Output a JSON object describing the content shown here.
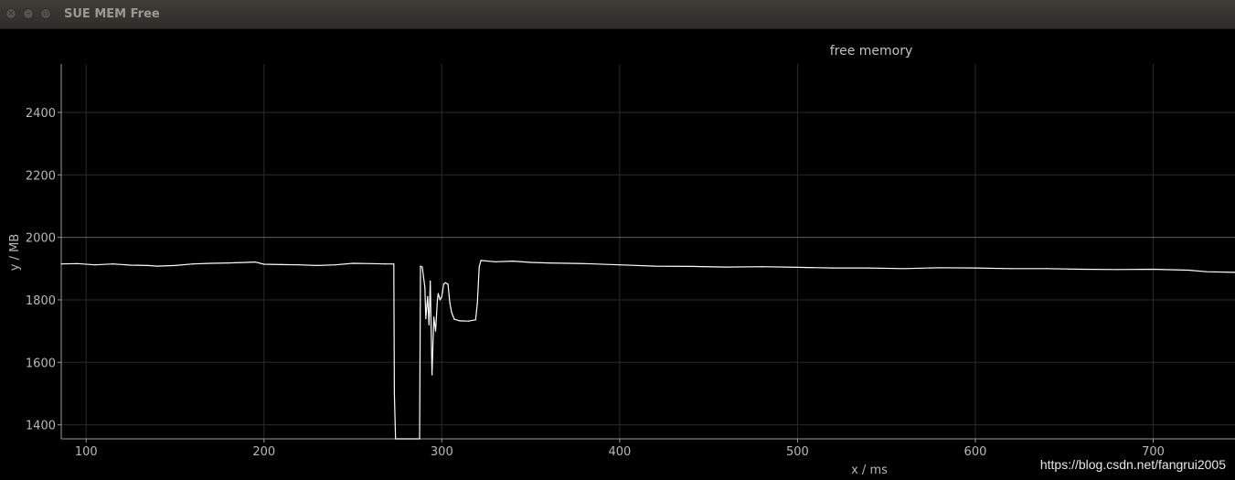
{
  "window": {
    "title": "SUE MEM Free",
    "buttons": {
      "close_icon": "close-icon",
      "minimize_icon": "minimize-icon",
      "maximize_icon": "maximize-icon"
    }
  },
  "watermark": "https://blog.csdn.net/fangrui2005",
  "colors": {
    "background": "#000000",
    "line": "#ffffff",
    "grid": "#2a2a2a",
    "axis": "#9a9a9a",
    "text": "#b8b8b8"
  },
  "chart_data": {
    "type": "line",
    "title": "free memory",
    "xlabel": "x / ms",
    "ylabel": "y / MB",
    "xlim": [
      86,
      746
    ],
    "ylim": [
      1355,
      2555
    ],
    "x_ticks": [
      100,
      200,
      300,
      400,
      500,
      600,
      700
    ],
    "y_ticks": [
      1400,
      1600,
      1800,
      2000,
      2200,
      2400
    ],
    "grid": true,
    "reference_lines": [
      2000
    ],
    "series": [
      {
        "values": [
          [
            86,
            1915
          ],
          [
            95,
            1916
          ],
          [
            105,
            1912
          ],
          [
            115,
            1915
          ],
          [
            125,
            1911
          ],
          [
            135,
            1910
          ],
          [
            140,
            1908
          ],
          [
            150,
            1910
          ],
          [
            160,
            1915
          ],
          [
            170,
            1917
          ],
          [
            180,
            1918
          ],
          [
            190,
            1920
          ],
          [
            195,
            1921
          ],
          [
            200,
            1914
          ],
          [
            210,
            1913
          ],
          [
            220,
            1912
          ],
          [
            230,
            1910
          ],
          [
            240,
            1912
          ],
          [
            250,
            1917
          ],
          [
            260,
            1916
          ],
          [
            268,
            1915
          ],
          [
            273,
            1915
          ],
          [
            273.3,
            1500
          ],
          [
            274,
            1355
          ],
          [
            287.5,
            1355
          ],
          [
            288,
            1908
          ],
          [
            289,
            1905
          ],
          [
            290.5,
            1840
          ],
          [
            291,
            1740
          ],
          [
            292,
            1810
          ],
          [
            292.8,
            1720
          ],
          [
            293.5,
            1860
          ],
          [
            294.5,
            1560
          ],
          [
            295.5,
            1745
          ],
          [
            296.5,
            1700
          ],
          [
            297.5,
            1800
          ],
          [
            298,
            1820
          ],
          [
            299,
            1800
          ],
          [
            300,
            1810
          ],
          [
            301,
            1850
          ],
          [
            302,
            1855
          ],
          [
            303.5,
            1850
          ],
          [
            304.5,
            1790
          ],
          [
            305.5,
            1760
          ],
          [
            307,
            1738
          ],
          [
            310,
            1733
          ],
          [
            315,
            1732
          ],
          [
            319,
            1736
          ],
          [
            320,
            1790
          ],
          [
            321,
            1905
          ],
          [
            322,
            1926
          ],
          [
            330,
            1922
          ],
          [
            340,
            1924
          ],
          [
            350,
            1920
          ],
          [
            360,
            1918
          ],
          [
            380,
            1916
          ],
          [
            400,
            1912
          ],
          [
            420,
            1908
          ],
          [
            440,
            1907
          ],
          [
            460,
            1905
          ],
          [
            480,
            1906
          ],
          [
            500,
            1904
          ],
          [
            520,
            1902
          ],
          [
            540,
            1902
          ],
          [
            560,
            1900
          ],
          [
            580,
            1903
          ],
          [
            600,
            1902
          ],
          [
            620,
            1900
          ],
          [
            640,
            1900
          ],
          [
            660,
            1898
          ],
          [
            680,
            1897
          ],
          [
            700,
            1898
          ],
          [
            720,
            1895
          ],
          [
            730,
            1890
          ],
          [
            746,
            1888
          ]
        ]
      }
    ]
  }
}
